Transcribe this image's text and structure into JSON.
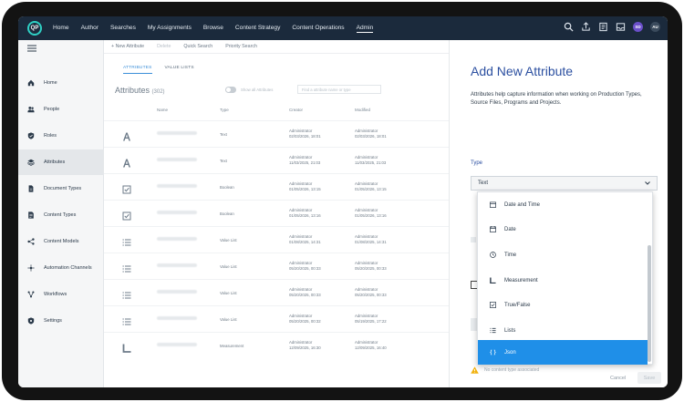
{
  "nav": {
    "logo": "QP",
    "items": [
      "Home",
      "Author",
      "Searches",
      "My Assignments",
      "Browse",
      "Content Strategy",
      "Content Operations",
      "Admin"
    ],
    "active_index": 7,
    "avatars": [
      {
        "label": "SD",
        "color": "#6a4fc9"
      },
      {
        "label": "AU",
        "color": "#3a4a5c"
      }
    ]
  },
  "sidebar": {
    "items": [
      "Home",
      "People",
      "Roles",
      "Attributes",
      "Document Types",
      "Content Types",
      "Content Models",
      "Automation Channels",
      "Workflows",
      "Settings"
    ],
    "icons": [
      "home-icon",
      "people-icon",
      "shield-icon",
      "layers-icon",
      "document-icon",
      "content-type-icon",
      "model-icon",
      "channels-icon",
      "workflow-icon",
      "settings-icon"
    ],
    "active_index": 3
  },
  "toolbar": {
    "new": "+ New Attribute",
    "delete": "Delete",
    "quick": "Quick Search",
    "priority": "Priority Search"
  },
  "tabs": [
    "ATTRIBUTES",
    "VALUE LISTS"
  ],
  "list": {
    "title": "Attributes",
    "count": "(302)",
    "show_all": "Show all Attributes",
    "filter_placeholder": "Find a attribute name or type",
    "columns": [
      "Name",
      "Type",
      "Creator",
      "Modified"
    ],
    "rows": [
      {
        "icon": "text-icon",
        "type": "Text",
        "creator": "Administrator",
        "created": "02/03/2026, 18:01",
        "modifier": "Administrator",
        "modified": "02/03/2026, 18:01"
      },
      {
        "icon": "text-icon",
        "type": "Text",
        "creator": "Administrator",
        "created": "11/03/2025, 21:03",
        "modifier": "Administrator",
        "modified": "11/03/2025, 21:03"
      },
      {
        "icon": "checkbox-icon",
        "type": "Boolean",
        "creator": "Administrator",
        "created": "01/05/2026, 13:15",
        "modifier": "Administrator",
        "modified": "01/05/2026, 13:15"
      },
      {
        "icon": "checkbox-icon",
        "type": "Boolean",
        "creator": "Administrator",
        "created": "01/05/2026, 13:16",
        "modifier": "Administrator",
        "modified": "01/05/2026, 13:16"
      },
      {
        "icon": "list-icon",
        "type": "Value List",
        "creator": "Administrator",
        "created": "01/08/2025, 14:31",
        "modifier": "Administrator",
        "modified": "01/08/2025, 14:31"
      },
      {
        "icon": "list-icon",
        "type": "Value List",
        "creator": "Administrator",
        "created": "05/20/2025, 00:33",
        "modifier": "Administrator",
        "modified": "05/20/2025, 00:33"
      },
      {
        "icon": "list-icon",
        "type": "Value List",
        "creator": "Administrator",
        "created": "05/20/2025, 00:33",
        "modifier": "Administrator",
        "modified": "05/20/2025, 00:33"
      },
      {
        "icon": "list-icon",
        "type": "Value List",
        "creator": "Administrator",
        "created": "05/20/2025, 00:32",
        "modifier": "Administrator",
        "modified": "05/19/2025, 17:22"
      },
      {
        "icon": "measurement-icon",
        "type": "Measurement",
        "creator": "Administrator",
        "created": "12/09/2025, 16:30",
        "modifier": "Administrator",
        "modified": "12/09/2025, 16:40"
      }
    ]
  },
  "panel": {
    "title": "Add New Attribute",
    "desc_1": "Attributes help capture information when working on Production Types,",
    "desc_2": "Source Files, Programs and Projects.",
    "type_label": "Type",
    "type_value": "Text",
    "options": [
      "Date and Time",
      "Date",
      "Time",
      "Measurement",
      "True/False",
      "Lists",
      "Json"
    ],
    "option_icons": [
      "calendar-clock-icon",
      "calendar-icon",
      "clock-icon",
      "measurement-icon",
      "checkbox-icon",
      "list-icon",
      "json-icon"
    ],
    "selected_option_index": 6,
    "warning": "No content type associated",
    "cancel": "Cancel",
    "save": "Save"
  }
}
